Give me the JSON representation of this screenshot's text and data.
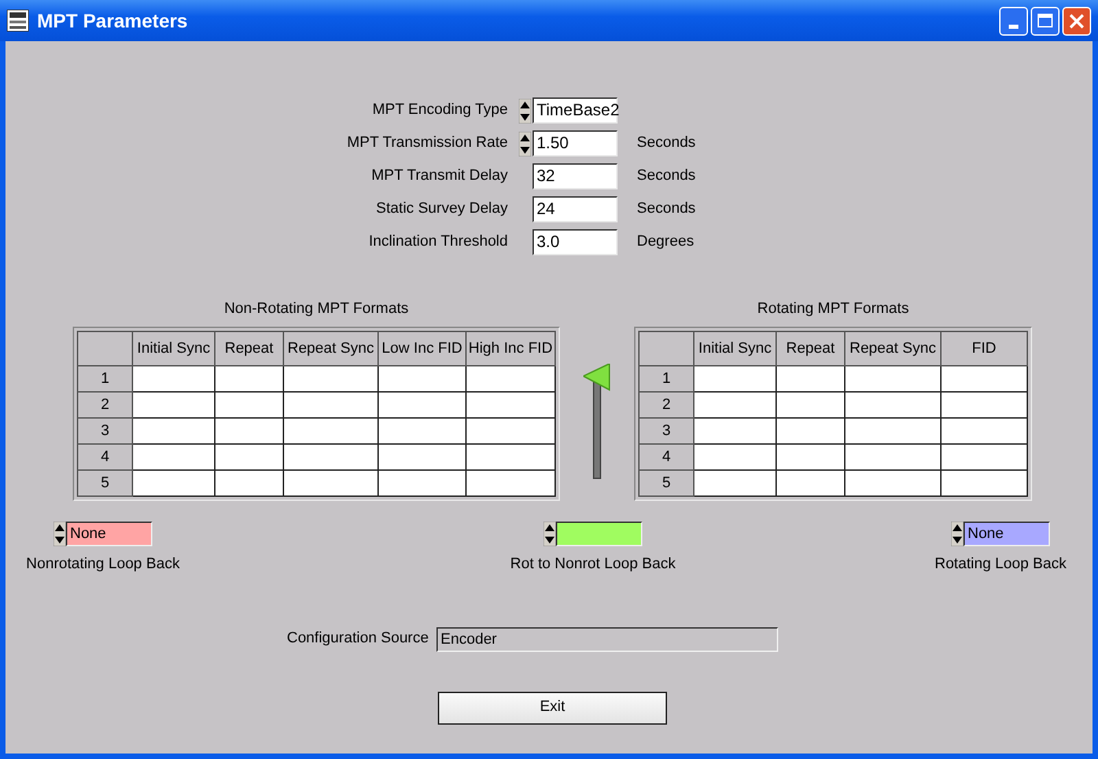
{
  "window": {
    "title": "MPT Parameters"
  },
  "parameters": [
    {
      "label": "MPT Encoding Type",
      "kind": "spinner",
      "value": "TimeBase2"
    },
    {
      "label": "MPT Transmission Rate",
      "kind": "spinner",
      "value": "1.50",
      "unit": "Seconds"
    },
    {
      "label": "MPT Transmit Delay",
      "kind": "field",
      "value": "32",
      "unit": "Seconds"
    },
    {
      "label": "Static Survey Delay",
      "kind": "field",
      "value": "24",
      "unit": "Seconds"
    },
    {
      "label": "Inclination Threshold",
      "kind": "field",
      "value": "3.0",
      "unit": "Degrees"
    }
  ],
  "tables": [
    {
      "title": "Non-Rotating MPT Formats",
      "columns": [
        "Initial Sync",
        "Repeat",
        "Repeat Sync",
        "Low Inc FID",
        "High Inc FID"
      ],
      "rows": [
        "1",
        "2",
        "3",
        "4",
        "5"
      ]
    },
    {
      "title": "Rotating MPT Formats",
      "columns": [
        "Initial Sync",
        "Repeat",
        "Repeat Sync",
        "FID"
      ],
      "rows": [
        "1",
        "2",
        "3",
        "4",
        "5"
      ]
    }
  ],
  "slider": {
    "level": 1
  },
  "loop_backs": [
    {
      "label": "Nonrotating Loop Back",
      "value": "None",
      "color": "#ffa4a4"
    },
    {
      "label": "Rot to Nonrot Loop Back",
      "color": "#a0fc60"
    },
    {
      "label": "Rotating Loop Back",
      "value": "None",
      "color": "#a8a8ff"
    }
  ],
  "configuration_source": {
    "label": "Configuration Source",
    "value": "Encoder"
  },
  "buttons": [
    "Exit"
  ]
}
